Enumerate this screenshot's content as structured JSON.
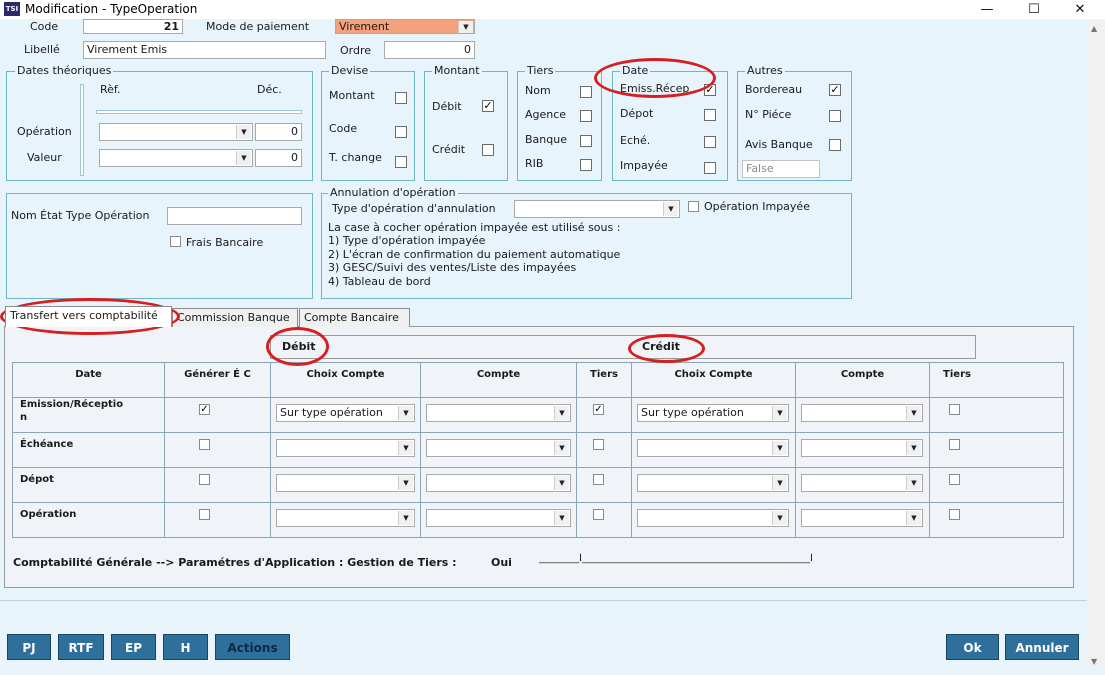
{
  "window": {
    "title": "Modification - TypeOperation",
    "logo": "TSI",
    "minimize_glyph": "—",
    "maximize_glyph": "☐",
    "close_glyph": "✕"
  },
  "header": {
    "code_label": "Code",
    "code_value": "21",
    "mode_label": "Mode de paiement",
    "mode_value": "Virement",
    "libelle_label": "Libellé",
    "libelle_value": "Virement Emis",
    "ordre_label": "Ordre",
    "ordre_value": "0"
  },
  "dates_theoriques": {
    "title": "Dates théoriques",
    "ref_label": "Rèf.",
    "dec_label": "Déc.",
    "operation_label": "Opération",
    "operation_value": "0",
    "valeur_label": "Valeur",
    "valeur_value": "0"
  },
  "devise": {
    "title": "Devise",
    "items": [
      {
        "label": "Montant",
        "checked": false
      },
      {
        "label": "Code",
        "checked": false
      },
      {
        "label": "T. change",
        "checked": false
      }
    ]
  },
  "montant": {
    "title": "Montant",
    "items": [
      {
        "label": "Débit",
        "checked": true
      },
      {
        "label": "Crédit",
        "checked": false
      }
    ]
  },
  "tiers": {
    "title": "Tiers",
    "items": [
      {
        "label": "Nom",
        "checked": false
      },
      {
        "label": "Agence",
        "checked": false
      },
      {
        "label": "Banque",
        "checked": false
      },
      {
        "label": "RIB",
        "checked": false
      }
    ]
  },
  "date": {
    "title": "Date",
    "items": [
      {
        "label": "Emiss.Récep",
        "checked": true
      },
      {
        "label": "Dépot",
        "checked": false
      },
      {
        "label": "Eché.",
        "checked": false
      },
      {
        "label": "Impayée",
        "checked": false
      }
    ]
  },
  "autres": {
    "title": "Autres",
    "items": [
      {
        "label": "Bordereau",
        "checked": true
      },
      {
        "label": "N° Piéce",
        "checked": false
      },
      {
        "label": "Avis Banque",
        "checked": false
      }
    ],
    "avis_value": "False"
  },
  "etat": {
    "nom_label": "Nom État Type Opération",
    "nom_value": "",
    "frais_label": "Frais Bancaire",
    "frais_checked": false
  },
  "annulation": {
    "title": "Annulation d'opération",
    "type_label": "Type d'opération d'annulation",
    "type_value": "",
    "impayee_label": "Opération Impayée",
    "impayee_checked": false,
    "note": "La case à cocher opération impayée est utilisé sous :",
    "lines": [
      "1) Type d'opération impayée",
      "2) L'écran de confirmation du paiement automatique",
      "3) GESC/Suivi des ventes/Liste des impayées",
      "4) Tableau de bord"
    ]
  },
  "tabs": [
    {
      "label": "Transfert vers comptabilité",
      "active": true
    },
    {
      "label": "Commission Banque",
      "active": false
    },
    {
      "label": "Compte Bancaire",
      "active": false
    }
  ],
  "transfert": {
    "debit_title": "Débit",
    "credit_title": "Crédit",
    "columns": [
      "Date",
      "Générer É C",
      "Choix Compte",
      "Compte",
      "Tiers",
      "Choix Compte",
      "Compte",
      "Tiers"
    ],
    "rows": [
      {
        "label_l1": "Emission/Réceptio",
        "label_l2": "n",
        "generer": true,
        "debit_choix": "Sur type opération",
        "debit_compte": "",
        "debit_tiers": true,
        "credit_choix": "Sur type opération",
        "credit_compte": "",
        "credit_tiers": false
      },
      {
        "label_l1": "Échéance",
        "label_l2": "",
        "generer": false,
        "debit_choix": "",
        "debit_compte": "",
        "debit_tiers": false,
        "credit_choix": "",
        "credit_compte": "",
        "credit_tiers": false
      },
      {
        "label_l1": "Dépot",
        "label_l2": "",
        "generer": false,
        "debit_choix": "",
        "debit_compte": "",
        "debit_tiers": false,
        "credit_choix": "",
        "credit_compte": "",
        "credit_tiers": false
      },
      {
        "label_l1": "Opération",
        "label_l2": "",
        "generer": false,
        "debit_choix": "",
        "debit_compte": "",
        "debit_tiers": false,
        "credit_choix": "",
        "credit_compte": "",
        "credit_tiers": false
      }
    ],
    "footer_label": "Comptabilité Générale --> Paramétres d'Application : Gestion de Tiers :",
    "footer_value": "Oui",
    "footer_line_left": "________Ǐ_____________________________________________",
    "footer_line_right": "_________________________________________Ǐ"
  },
  "buttons": {
    "pj": "PJ",
    "rtf": "RTF",
    "ep": "EP",
    "h": "H",
    "actions": "Actions",
    "ok": "Ok",
    "annuler": "Annuler"
  },
  "icons": {
    "dropdown": "▼",
    "check": "✓",
    "scroll_up": "▲",
    "scroll_down": "▼"
  }
}
